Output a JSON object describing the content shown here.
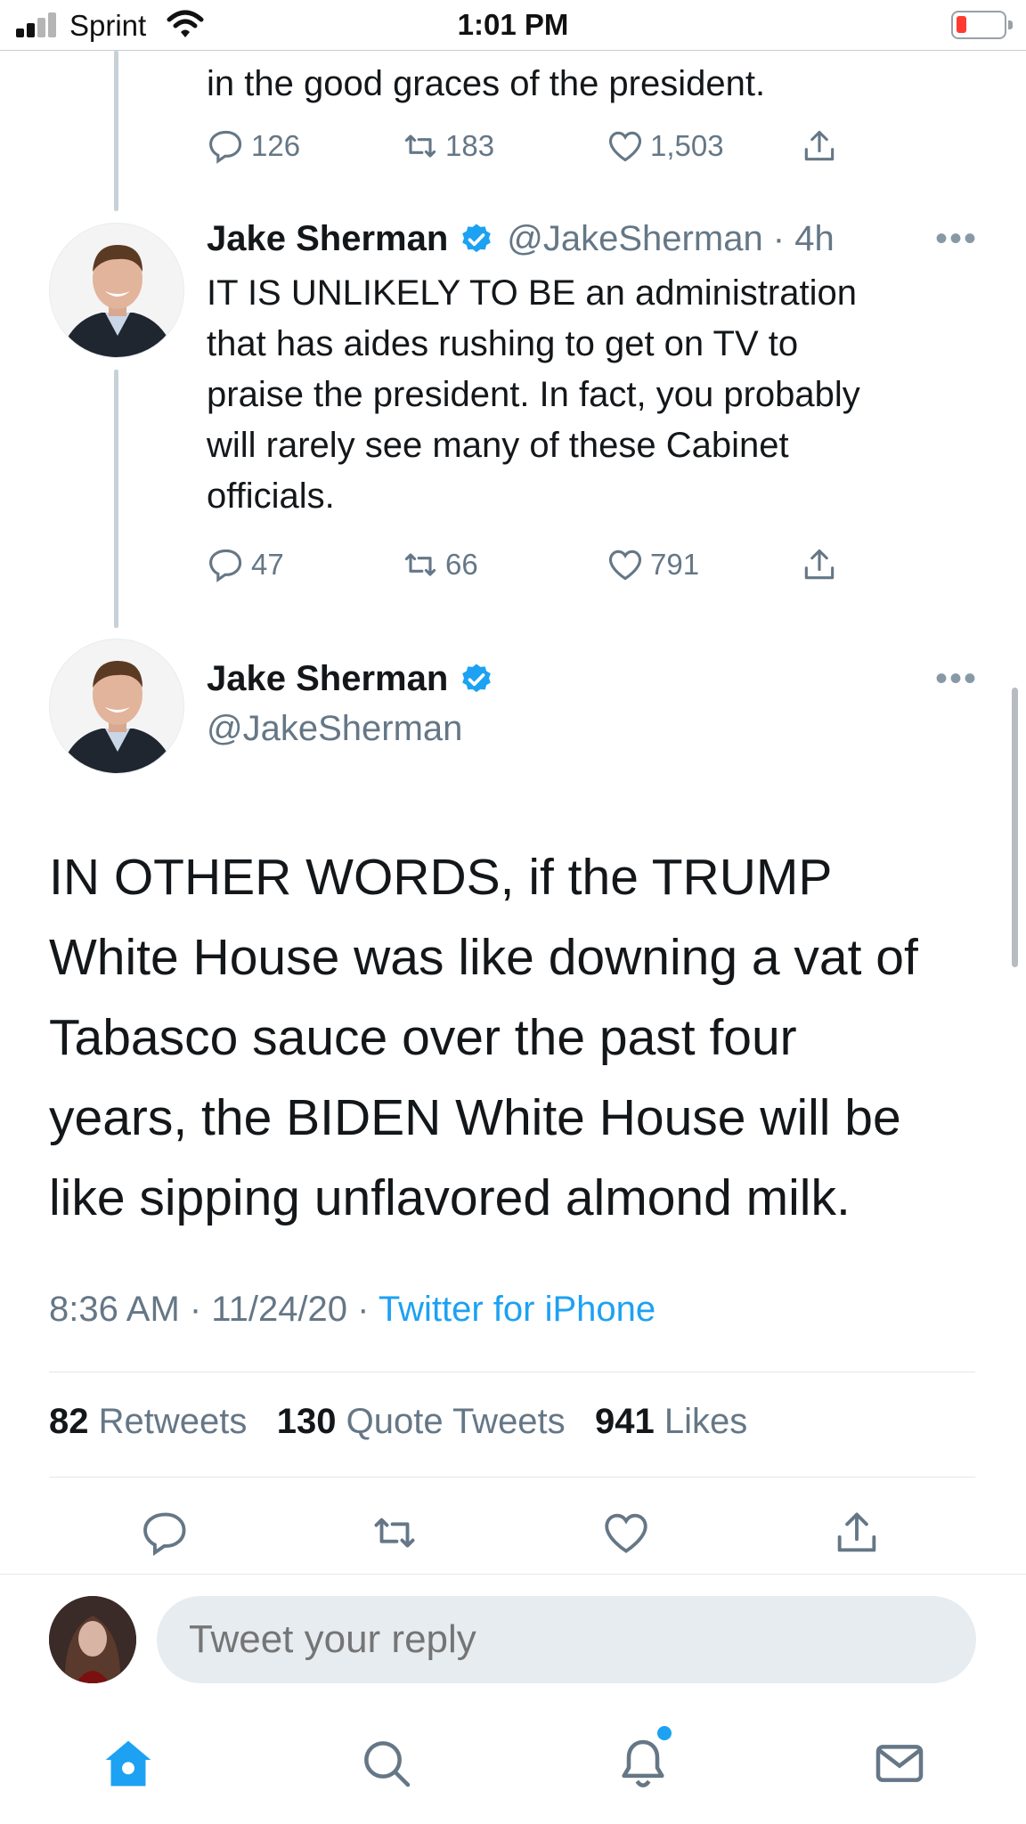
{
  "status_bar": {
    "carrier": "Sprint",
    "time": "1:01 PM",
    "battery_color": "#ff3b30"
  },
  "thread": {
    "partial_tweet": {
      "visible_text": "in the good graces of the president.",
      "replies": "126",
      "retweets": "183",
      "likes": "1,503"
    },
    "previous_tweet": {
      "author_name": "Jake Sherman",
      "handle_time": "@JakeSherman · 4h",
      "text_lines": [
        "IT IS UNLIKELY TO BE an administration",
        "that has aides rushing to get on TV to",
        "praise the president. In fact, you probably",
        "will rarely see many of these Cabinet",
        "officials."
      ],
      "replies": "47",
      "retweets": "66",
      "likes": "791"
    }
  },
  "main_tweet": {
    "author_name": "Jake Sherman",
    "handle": "@JakeSherman",
    "text_lines": [
      "IN OTHER WORDS, if the TRUMP",
      "White House was like downing a vat of",
      "Tabasco sauce over the past four",
      "years, the BIDEN White House will be",
      "like sipping unflavored almond milk."
    ],
    "timestamp": "8:36 AM · 11/24/20 · ",
    "source": "Twitter for iPhone",
    "retweets_count": "82",
    "retweets_label": "Retweets",
    "quote_count": "130",
    "quote_label": "Quote Tweets",
    "likes_count": "941",
    "likes_label": "Likes"
  },
  "reply": {
    "placeholder": "Tweet your reply"
  },
  "tab_bar": {
    "icons": [
      "home-icon",
      "search-icon",
      "notifications-icon",
      "messages-icon"
    ],
    "active": "home-icon",
    "accent_color": "#1da1f2"
  },
  "colors": {
    "text": "#14171a",
    "secondary": "#657786",
    "accent": "#1da1f2",
    "verified": "#1da1f2"
  }
}
